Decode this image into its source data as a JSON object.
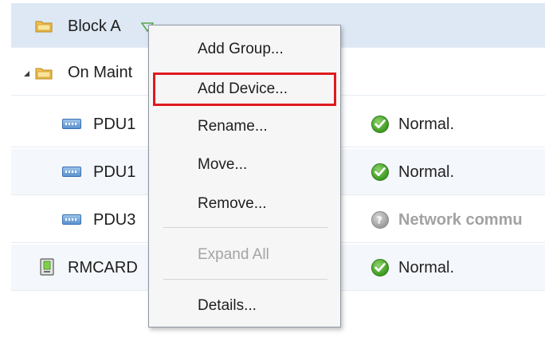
{
  "tree": {
    "rows": [
      {
        "label": "Block A",
        "icon": "folder-icon"
      },
      {
        "label": "On Maint",
        "icon": "folder-icon"
      },
      {
        "label": "PDU1",
        "icon": "pdu-icon",
        "status": "Normal.",
        "status_icon": "check-icon"
      },
      {
        "label": "PDU1",
        "icon": "pdu-icon",
        "status": "Normal.",
        "status_icon": "check-icon"
      },
      {
        "label": "PDU3",
        "icon": "pdu-icon",
        "status": "Network commu",
        "status_icon": "question-icon"
      },
      {
        "label": "RMCARD",
        "icon": "card-icon",
        "status": "Normal.",
        "status_icon": "check-icon"
      }
    ]
  },
  "context_menu": {
    "items": [
      {
        "label": "Add Group...",
        "enabled": true
      },
      {
        "label": "Add Device...",
        "enabled": true,
        "highlighted": true
      },
      {
        "label": "Rename...",
        "enabled": true
      },
      {
        "label": "Move...",
        "enabled": true
      },
      {
        "label": "Remove...",
        "enabled": true
      },
      {
        "label": "Expand All",
        "enabled": false
      },
      {
        "label": "Details...",
        "enabled": true
      }
    ]
  },
  "colors": {
    "selected_row": "#dde8f4",
    "highlight_outline": "#e0191e",
    "status_ok": "#3e9a22",
    "status_unknown": "#9c9c9c"
  }
}
